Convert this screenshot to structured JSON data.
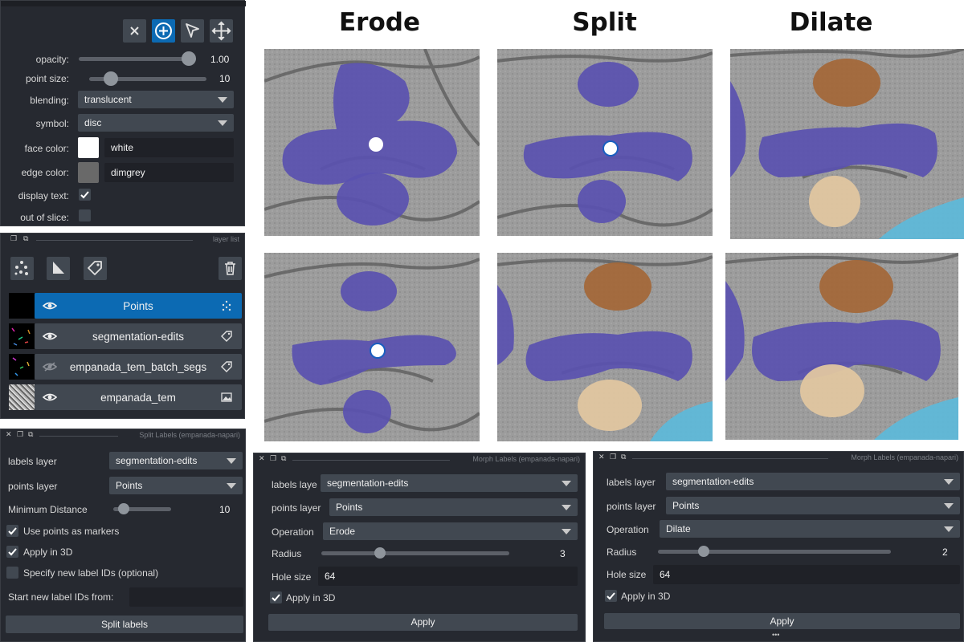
{
  "titles": {
    "erode": "Erode",
    "split": "Split",
    "dilate": "Dilate"
  },
  "points_controls": {
    "opacity_label": "opacity:",
    "opacity_value": "1.00",
    "opacity_level": 1.0,
    "point_size_label": "point size:",
    "point_size_value": "10",
    "point_size_level": 0.14,
    "blending_label": "blending:",
    "blending_value": "translucent",
    "symbol_label": "symbol:",
    "symbol_value": "disc",
    "face_color_label": "face color:",
    "face_color_value": "white",
    "face_color_swatch": "#ffffff",
    "edge_color_label": "edge color:",
    "edge_color_value": "dimgrey",
    "edge_color_swatch": "#696969",
    "display_text_label": "display text:",
    "display_text_checked": true,
    "out_of_slice_label": "out of slice:",
    "out_of_slice_checked": false,
    "mode_buttons": [
      "close-icon",
      "add-point-icon",
      "select-arrow-icon",
      "pan-zoom-icon"
    ]
  },
  "layer_list": {
    "header": "layer list",
    "layers": [
      {
        "name": "Points",
        "visible": true,
        "selected": true,
        "type_icon": "points-icon"
      },
      {
        "name": "segmentation-edits",
        "visible": true,
        "selected": false,
        "type_icon": "labels-icon"
      },
      {
        "name": "empanada_tem_batch_segs",
        "visible": false,
        "selected": false,
        "type_icon": "labels-icon"
      },
      {
        "name": "empanada_tem",
        "visible": true,
        "selected": false,
        "type_icon": "image-icon"
      }
    ]
  },
  "split_panel": {
    "header": "Split Labels (empanada-napari)",
    "labels_layer_label": "labels layer",
    "labels_layer_value": "segmentation-edits",
    "points_layer_label": "points layer",
    "points_layer_value": "Points",
    "min_distance_label": "Minimum Distance",
    "min_distance_value": "10",
    "min_distance_level": 0.1,
    "use_points_label": "Use points as markers",
    "use_points_checked": true,
    "apply3d_label": "Apply in 3D",
    "apply3d_checked": true,
    "specify_ids_label": "Specify new label IDs (optional)",
    "specify_ids_checked": false,
    "start_ids_label": "Start new label IDs from:",
    "start_ids_value": "",
    "button": "Split labels"
  },
  "morph_erode": {
    "header": "Morph Labels (empanada-napari)",
    "labels_layer_label": "labels laye",
    "labels_layer_value": "segmentation-edits",
    "points_layer_label": "points layer",
    "points_layer_value": "Points",
    "operation_label": "Operation",
    "operation_value": "Erode",
    "radius_label": "Radius",
    "radius_value": "3",
    "radius_level": 0.3,
    "hole_size_label": "Hole size",
    "hole_size_value": "64",
    "apply3d_label": "Apply in 3D",
    "apply3d_checked": true,
    "button": "Apply"
  },
  "morph_dilate": {
    "header": "Morph Labels (empanada-napari)",
    "labels_layer_label": "labels layer",
    "labels_layer_value": "segmentation-edits",
    "points_layer_label": "points layer",
    "points_layer_value": "Points",
    "operation_label": "Operation",
    "operation_value": "Dilate",
    "radius_label": "Radius",
    "radius_value": "2",
    "radius_level": 0.18,
    "hole_size_label": "Hole size",
    "hole_size_value": "64",
    "apply3d_label": "Apply in 3D",
    "apply3d_checked": true,
    "button": "Apply",
    "more": "•••"
  },
  "colors": {
    "panel_bg": "#262930",
    "control_bg": "#414851",
    "selected": "#0c6ab3",
    "mito_purple": "#5a51b0",
    "mito_orange": "#a3683a",
    "mito_tan": "#e0c6a0",
    "mito_cyan": "#5fb8d8"
  }
}
